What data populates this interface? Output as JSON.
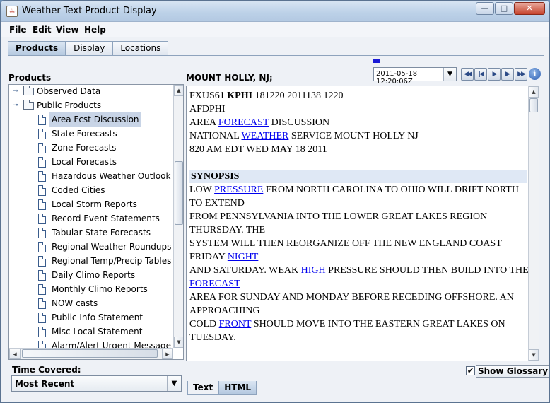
{
  "window": {
    "title": "Weather Text Product Display",
    "buttons": {
      "minimize": "—",
      "maximize": "□",
      "close": "✕"
    }
  },
  "menu": [
    "File",
    "Edit",
    "View",
    "Help"
  ],
  "tabs": [
    {
      "label": "Products",
      "active": true
    },
    {
      "label": "Display",
      "active": false
    },
    {
      "label": "Locations",
      "active": false
    }
  ],
  "left_panel": {
    "label": "Products",
    "tree": [
      {
        "label": "Observed Data",
        "type": "folder",
        "level": 0
      },
      {
        "label": "Public Products",
        "type": "folder",
        "level": 0
      },
      {
        "label": "Area Fcst Discussion",
        "type": "doc",
        "level": 1,
        "selected": true
      },
      {
        "label": "State Forecasts",
        "type": "doc",
        "level": 1
      },
      {
        "label": "Zone Forecasts",
        "type": "doc",
        "level": 1
      },
      {
        "label": "Local Forecasts",
        "type": "doc",
        "level": 1
      },
      {
        "label": "Hazardous Weather Outlook",
        "type": "doc",
        "level": 1
      },
      {
        "label": "Coded Cities",
        "type": "doc",
        "level": 1
      },
      {
        "label": "Local Storm Reports",
        "type": "doc",
        "level": 1
      },
      {
        "label": "Record Event Statements",
        "type": "doc",
        "level": 1
      },
      {
        "label": "Tabular State Forecasts",
        "type": "doc",
        "level": 1
      },
      {
        "label": "Regional Weather Roundups",
        "type": "doc",
        "level": 1
      },
      {
        "label": "Regional Temp/Precip Tables",
        "type": "doc",
        "level": 1
      },
      {
        "label": "Daily Climo Reports",
        "type": "doc",
        "level": 1
      },
      {
        "label": "Monthly Climo Reports",
        "type": "doc",
        "level": 1
      },
      {
        "label": "NOW casts",
        "type": "doc",
        "level": 1
      },
      {
        "label": "Public Info Statement",
        "type": "doc",
        "level": 1
      },
      {
        "label": "Misc Local Statement",
        "type": "doc",
        "level": 1
      },
      {
        "label": "Alarm/Alert Urgent Message",
        "type": "doc",
        "level": 1
      }
    ],
    "time_covered_label": "Time Covered:",
    "time_covered_value": "Most Recent"
  },
  "right_panel": {
    "product_title": "MOUNT HOLLY, NJ;",
    "date_value": "2011-05-18 12:20:06Z",
    "nav_buttons": [
      "first",
      "previous",
      "next",
      "last",
      "newest"
    ],
    "text_lines": [
      {
        "parts": [
          {
            "t": "FXUS61 "
          },
          {
            "t": "KPHI",
            "bold": true
          },
          {
            "t": " 181220 2011138 1220"
          }
        ]
      },
      {
        "parts": [
          {
            "t": "AFDPHI"
          }
        ]
      },
      {
        "parts": [
          {
            "t": "AREA "
          },
          {
            "t": "FORECAST",
            "link": true
          },
          {
            "t": " DISCUSSION"
          }
        ]
      },
      {
        "parts": [
          {
            "t": "NATIONAL "
          },
          {
            "t": "WEATHER",
            "link": true
          },
          {
            "t": " SERVICE MOUNT HOLLY NJ"
          }
        ]
      },
      {
        "parts": [
          {
            "t": "820 AM EDT WED MAY 18 2011"
          }
        ]
      },
      {
        "parts": [],
        "blank": true
      },
      {
        "parts": [
          {
            "t": "SYNOPSIS"
          }
        ],
        "heading": true
      },
      {
        "parts": [
          {
            "t": "LOW "
          },
          {
            "t": "PRESSURE",
            "link": true
          },
          {
            "t": " FROM NORTH CAROLINA TO OHIO WILL DRIFT NORTH"
          }
        ]
      },
      {
        "parts": [
          {
            "t": "TO EXTEND"
          }
        ]
      },
      {
        "parts": [
          {
            "t": "FROM PENNSYLVANIA INTO THE LOWER GREAT LAKES REGION"
          }
        ]
      },
      {
        "parts": [
          {
            "t": "THURSDAY. THE"
          }
        ]
      },
      {
        "parts": [
          {
            "t": "SYSTEM WILL THEN REORGANIZE OFF THE NEW ENGLAND COAST"
          }
        ]
      },
      {
        "parts": [
          {
            "t": "FRIDAY "
          },
          {
            "t": "NIGHT",
            "link": true
          }
        ]
      },
      {
        "parts": [
          {
            "t": "AND SATURDAY. WEAK "
          },
          {
            "t": "HIGH",
            "link": true
          },
          {
            "t": " PRESSURE SHOULD THEN BUILD INTO THE"
          }
        ]
      },
      {
        "parts": [
          {
            "t": "FORECAST",
            "link": true
          }
        ]
      },
      {
        "parts": [
          {
            "t": "AREA FOR SUNDAY AND MONDAY BEFORE RECEDING OFFSHORE. AN"
          }
        ]
      },
      {
        "parts": [
          {
            "t": "APPROACHING"
          }
        ]
      },
      {
        "parts": [
          {
            "t": "COLD "
          },
          {
            "t": "FRONT",
            "link": true
          },
          {
            "t": " SHOULD MOVE INTO THE EASTERN GREAT LAKES ON"
          }
        ]
      },
      {
        "parts": [
          {
            "t": "TUESDAY."
          }
        ]
      }
    ],
    "show_glossary_label": "Show Glossary",
    "show_glossary_checked": true,
    "bottom_tabs": [
      {
        "label": "Text",
        "active": true
      },
      {
        "label": "HTML",
        "active": false
      }
    ]
  },
  "colors": {
    "link": "#0000ee",
    "selection": "#c8d4e6",
    "heading_bg": "#dfe8f5",
    "marker": "#1a1ad6"
  }
}
